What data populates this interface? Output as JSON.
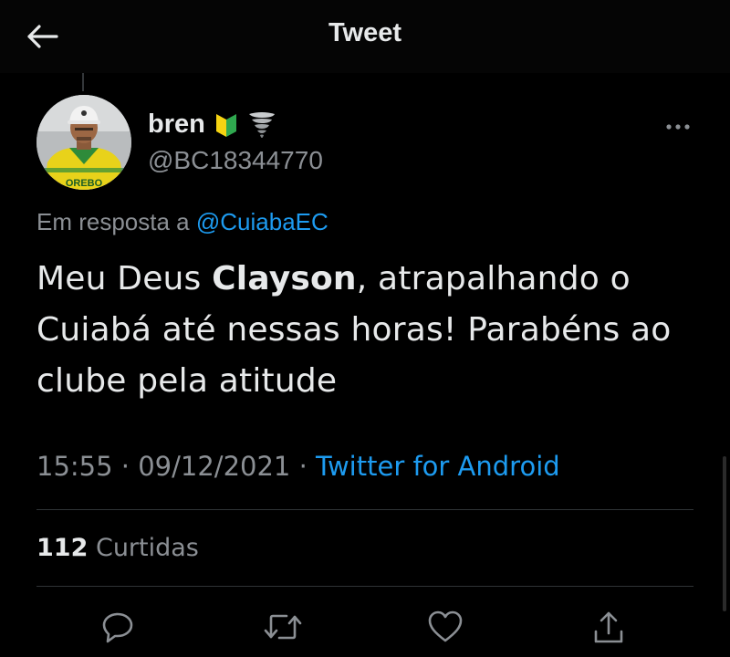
{
  "header": {
    "title": "Tweet",
    "back_icon": "arrow-left-icon"
  },
  "author": {
    "display_name": "bren",
    "handle": "@BC18344770",
    "badges": [
      "beginner-symbol-icon",
      "tornado-icon"
    ],
    "avatar_jersey_text": "OREBO"
  },
  "reply": {
    "prefix": "Em resposta a",
    "mention": "@CuiabaEC"
  },
  "tweet": {
    "text_before": "Meu Deus ",
    "text_bold": "Clayson",
    "text_after": ", atrapalhando o Cuiabá até nessas horas! Parabéns ao clube pela atitude"
  },
  "meta": {
    "time": "15:55",
    "separator": "·",
    "date": "09/12/2021",
    "source": "Twitter for Android"
  },
  "stats": {
    "likes_count": "112",
    "likes_label": "Curtidas"
  },
  "actions": [
    "reply-icon",
    "retweet-icon",
    "like-icon",
    "share-icon"
  ],
  "colors": {
    "background": "#000000",
    "text": "#e7e9ea",
    "secondary": "#8b8f94",
    "link": "#1d9bf0",
    "divider": "#2f3336"
  }
}
